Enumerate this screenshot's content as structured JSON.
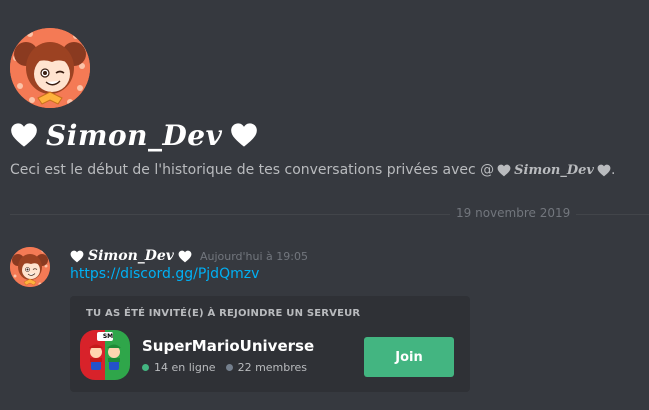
{
  "dm_header": {
    "username": "Simon_Dev",
    "intro_text": "Ceci est le début de l'historique de tes conversations privées avec @",
    "intro_suffix": "."
  },
  "divider": {
    "date": "19 novembre 2019"
  },
  "message": {
    "author": "Simon_Dev",
    "timestamp": "Aujourd'hui à 19:05",
    "link": "https://discord.gg/PjdQmzv"
  },
  "invite": {
    "heading": "TU AS ÉTÉ INVITÉ(E) À REJOINDRE UN SERVEUR",
    "server_name": "SuperMarioUniverse",
    "online": "14 en ligne",
    "members": "22 membres",
    "join_label": "Join",
    "icon_badge": "SM"
  },
  "colors": {
    "background": "#36393f",
    "card": "#2f3136",
    "link": "#00b0f4",
    "join_button": "#43b581",
    "online_dot": "#43b581",
    "members_dot": "#747f8d"
  }
}
